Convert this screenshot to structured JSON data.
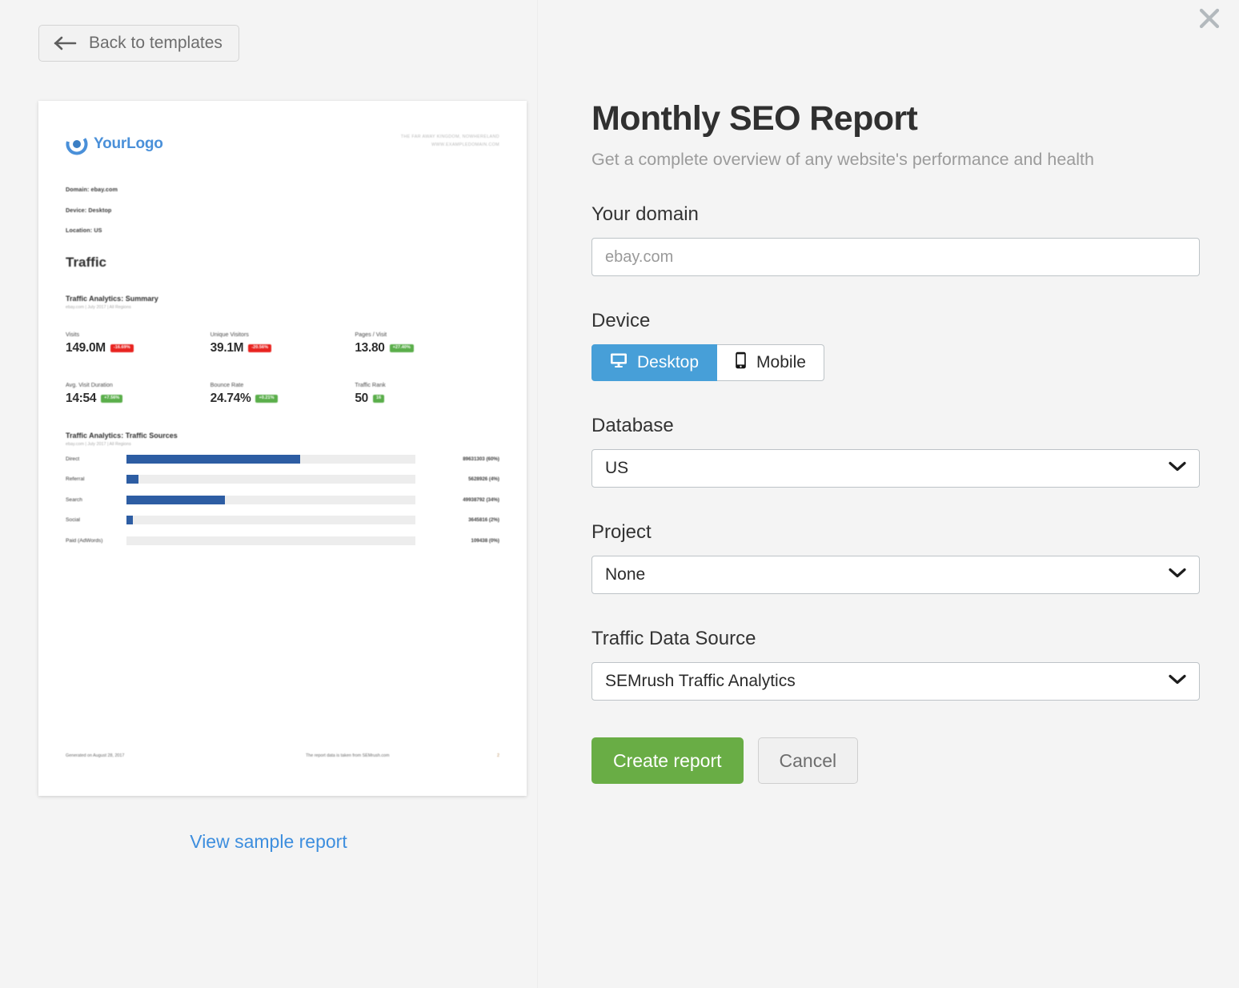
{
  "topbar": {
    "back_label": "Back to templates",
    "close_label": "×"
  },
  "preview": {
    "logo_text": "YourLogo",
    "address_line1": "THE FAR AWAY KINGDOM, NOWHERELAND",
    "address_line2": "WWW.EXAMPLEDOMAIN.COM",
    "meta": [
      "Domain: ebay.com",
      "Device: Desktop",
      "Location: US"
    ],
    "section_title": "Traffic",
    "summary": {
      "heading": "Traffic Analytics: Summary",
      "subheading": "ebay.com | July 2017 | All Regions"
    },
    "sources": {
      "heading": "Traffic Analytics: Traffic Sources",
      "subheading": "ebay.com | July 2017 | All Regions"
    },
    "footer": {
      "left": "Generated on August 28, 2017",
      "middle": "The report data is taken from SEMrush.com",
      "right": "2"
    },
    "sample_link": "View sample report"
  },
  "chart_data": [
    {
      "type": "table",
      "title": "Traffic Analytics: Summary",
      "subtitle": "ebay.com | July 2017 | All Regions",
      "categories": [
        "Visits",
        "Unique Visitors",
        "Pages / Visit",
        "Avg. Visit Duration",
        "Bounce Rate",
        "Traffic Rank"
      ],
      "metrics": [
        {
          "label": "Visits",
          "value": "149.0M",
          "delta": "-16.69%",
          "direction": "down"
        },
        {
          "label": "Unique Visitors",
          "value": "39.1M",
          "delta": "-20.56%",
          "direction": "down"
        },
        {
          "label": "Pages / Visit",
          "value": "13.80",
          "delta": "+27.40%",
          "direction": "up"
        },
        {
          "label": "Avg. Visit Duration",
          "value": "14:54",
          "delta": "+7.56%",
          "direction": "up"
        },
        {
          "label": "Bounce Rate",
          "value": "24.74%",
          "delta": "+0.21%",
          "direction": "up"
        },
        {
          "label": "Traffic Rank",
          "value": "50",
          "delta": "16",
          "direction": "rank"
        }
      ]
    },
    {
      "type": "bar",
      "orientation": "horizontal",
      "title": "Traffic Analytics: Traffic Sources",
      "subtitle": "ebay.com | July 2017 | All Regions",
      "xlabel": "",
      "ylabel": "",
      "grid": false,
      "legend": "none",
      "categories": [
        "Direct",
        "Referral",
        "Search",
        "Social",
        "Paid (AdWords)"
      ],
      "values": [
        89631303,
        5628926,
        49938792,
        3645816,
        109438
      ],
      "percentages": [
        60,
        4,
        34,
        2,
        0
      ],
      "value_labels": [
        "89631303 (60%)",
        "5628926 (4%)",
        "49938792 (34%)",
        "3645816 (2%)",
        "109438 (0%)"
      ],
      "bar_color": "#2d5da3",
      "track_color": "#ededed"
    }
  ],
  "form": {
    "title": "Monthly SEO Report",
    "subtitle": "Get a complete overview of any website's performance and health",
    "domain": {
      "label": "Your domain",
      "value": "",
      "placeholder": "ebay.com"
    },
    "device": {
      "label": "Device",
      "options": [
        "Desktop",
        "Mobile"
      ],
      "selected": "Desktop"
    },
    "database": {
      "label": "Database",
      "selected": "US"
    },
    "project": {
      "label": "Project",
      "selected": "None"
    },
    "traffic_source": {
      "label": "Traffic Data Source",
      "selected": "SEMrush Traffic Analytics"
    },
    "buttons": {
      "primary": "Create report",
      "secondary": "Cancel"
    }
  },
  "colors": {
    "accent_blue": "#479fd8",
    "primary_green": "#69ad45",
    "link_blue": "#3d8ede",
    "bar_blue": "#2d5da3",
    "badge_up": "#5aae4a",
    "badge_down": "#e8231f",
    "background": "#f4f4f4"
  }
}
